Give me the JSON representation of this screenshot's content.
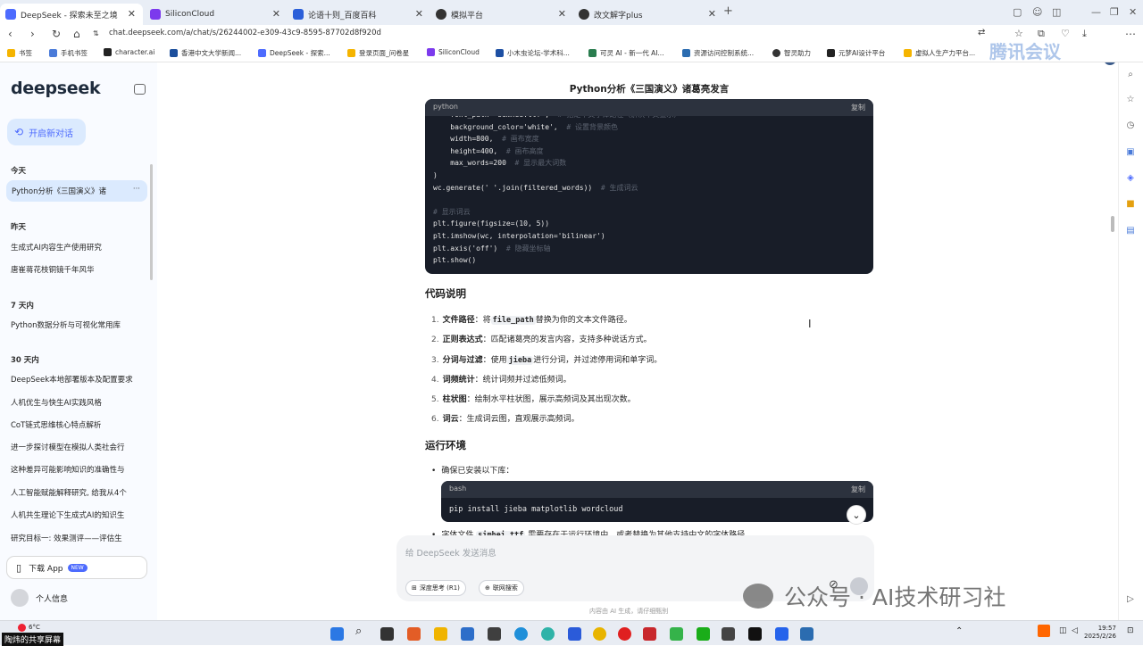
{
  "browser": {
    "tabs": [
      {
        "label": "DeepSeek - 探索未至之境",
        "icon": "deepseek-icon",
        "color": "#4d6bfe",
        "active": true
      },
      {
        "label": "SiliconCloud",
        "icon": "siliconcloud-icon",
        "color": "#7c3aed"
      },
      {
        "label": "论语十则_百度百科",
        "icon": "baike-icon",
        "color": "#2b5fd9"
      },
      {
        "label": "模拟平台",
        "icon": "chatgpt-icon",
        "color": "#333333"
      },
      {
        "label": "改文解字plus",
        "icon": "chatgpt-icon",
        "color": "#333333"
      }
    ],
    "url": "chat.deepseek.com/a/chat/s/26244002-e309-43c9-8595-87702d8f920d",
    "bookmarks": [
      {
        "label": "书签",
        "color": "#f5b400"
      },
      {
        "label": "手机书签",
        "color": "#4a7bd9"
      },
      {
        "label": "character.ai",
        "color": "#222222"
      },
      {
        "label": "香港中文大学新闻...",
        "color": "#1c4f9c"
      },
      {
        "label": "DeepSeek - 探索...",
        "color": "#4d6bfe"
      },
      {
        "label": "登录页面_问卷星",
        "color": "#f5b400"
      },
      {
        "label": "SiliconCloud",
        "color": "#7c3aed"
      },
      {
        "label": "小木虫论坛-学术科...",
        "color": "#1d4fa3"
      },
      {
        "label": "可灵 AI - 新一代 AI...",
        "color": "#2a7d4f"
      },
      {
        "label": "资源访问控制系统...",
        "color": "#2b6cb0"
      },
      {
        "label": "智灵助力",
        "color": "#333333"
      },
      {
        "label": "元梦AI设计平台",
        "color": "#222222"
      },
      {
        "label": "虚拟人生产力平台...",
        "color": "#f5b400"
      }
    ]
  },
  "sidebar": {
    "logo": "deepseek",
    "new_chat": "开启新对话",
    "sections": [
      {
        "label": "今天",
        "items": [
          "Python分析《三国演义》诸"
        ]
      },
      {
        "label": "昨天",
        "items": [
          "生成式AI内容生产使用研究",
          "唐崔蒋花枝铜镜千年风华"
        ]
      },
      {
        "label": "7 天内",
        "items": [
          "Python数据分析与可视化常用库"
        ]
      },
      {
        "label": "30 天内",
        "items": [
          "DeepSeek本地部署版本及配置要求",
          "人机优生与快生AI实践风格",
          "CoT链式思维核心特点解析",
          "进一步探讨模型在模拟人类社会行",
          "这种差异可能影响知识的准确性与",
          "人工智能赋能解释研究, 给我从4个",
          "人机共生理论下生成式AI的知识生",
          "研究目标一: 效果测评——评估生"
        ]
      }
    ],
    "download_app": "下载 App",
    "new_badge": "NEW",
    "profile": "个人信息"
  },
  "conversation": {
    "title": "Python分析《三国演义》诸葛亮发言",
    "code_block": {
      "lang": "python",
      "copy_label": "复制",
      "lines": [
        "    font_path='simhei.ttf',  # 指定中文字体路径（解决中文显示）",
        "    background_color='white',  # 设置背景颜色",
        "    width=800,  # 画布宽度",
        "    height=400,  # 画布高度",
        "    max_words=200  # 显示最大词数",
        ")",
        "wc.generate(' '.join(filtered_words))  # 生成词云",
        "",
        "# 显示词云",
        "plt.figure(figsize=(10, 5))",
        "plt.imshow(wc, interpolation='bilinear')",
        "plt.axis('off')  # 隐藏坐标轴",
        "plt.show()"
      ]
    },
    "explain_heading": "代码说明",
    "explain_items": [
      {
        "num": "1.",
        "title": "文件路径",
        "pre": "：将",
        "code": "file_path",
        "post": "替换为你的文本文件路径。"
      },
      {
        "num": "2.",
        "title": "正则表达式",
        "pre": "：匹配诸葛亮的发言内容，支持多种说话方式。",
        "code": "",
        "post": ""
      },
      {
        "num": "3.",
        "title": "分词与过滤",
        "pre": "：使用",
        "code": "jieba",
        "post": "进行分词，并过滤停用词和单字词。"
      },
      {
        "num": "4.",
        "title": "词频统计",
        "pre": "：统计词频并过滤低频词。",
        "code": "",
        "post": ""
      },
      {
        "num": "5.",
        "title": "柱状图",
        "pre": "：绘制水平柱状图，展示高频词及其出现次数。",
        "code": "",
        "post": ""
      },
      {
        "num": "6.",
        "title": "词云",
        "pre": "：生成词云图，直观展示高频词。",
        "code": "",
        "post": ""
      }
    ],
    "env_heading": "运行环境",
    "env_bullet1": "确保已安装以下库：",
    "bash_block": {
      "lang": "bash",
      "copy_label": "复制",
      "command": "pip install jieba matplotlib wordcloud"
    },
    "env_bullet2_pre": "字体文件",
    "env_bullet2_code": "simhei.ttf",
    "env_bullet2_post": "需要存在于运行环境中，或者替换为其他支持中文的字体路径。"
  },
  "composer": {
    "placeholder": "给 DeepSeek 发送消息",
    "deep_think": "深度思考 (R1)",
    "web_search": "联网搜索",
    "footnote": "内容由 AI 生成，请仔细甄别"
  },
  "watermarks": {
    "top": "腾讯会议",
    "bottom": "公众号 · AI技术研习社"
  },
  "taskbar": {
    "share_label": "陶炜的共享屏幕",
    "temperature": "6°C",
    "time": "19:57",
    "date": "2025/2/26"
  }
}
